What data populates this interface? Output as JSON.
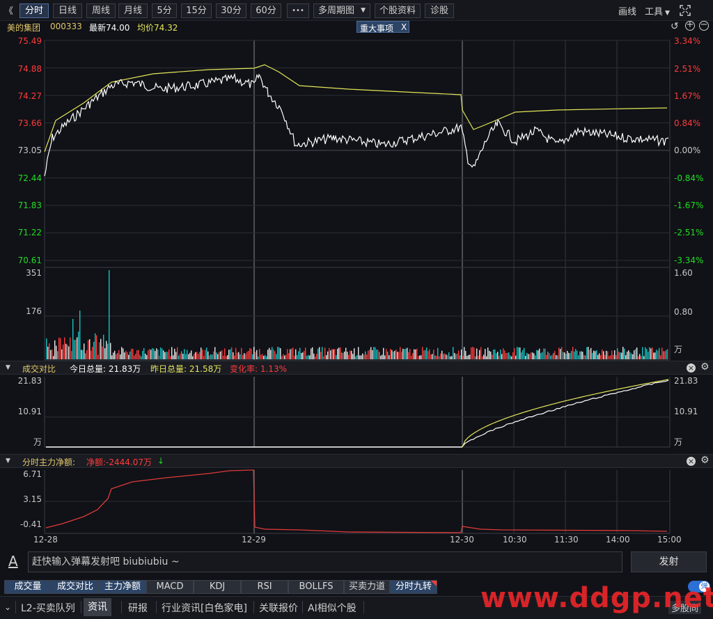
{
  "toolbar": {
    "collapse_glyph": "《",
    "periods": [
      "分时",
      "日线",
      "周线",
      "月线",
      "5分",
      "15分",
      "30分",
      "60分"
    ],
    "more_glyph": "•••",
    "multi_period": "多周期图",
    "stock_profile": "个股资料",
    "diagnose": "诊股",
    "draw_line": "画线",
    "tools": "工具",
    "fullscreen_icon": "expand-icon"
  },
  "stock": {
    "name": "美的集团",
    "code": "000333",
    "latest": "最新74.00",
    "avg_price": "均价74.32",
    "event_tag": "重大事项",
    "event_close": "X"
  },
  "price_axis": {
    "left": [
      "75.49",
      "74.88",
      "74.27",
      "73.66",
      "73.05",
      "72.44",
      "71.83",
      "71.22",
      "70.61"
    ],
    "right": [
      "3.34%",
      "2.51%",
      "1.67%",
      "0.84%",
      "0.00%",
      "-0.84%",
      "-1.67%",
      "-2.51%",
      "-3.34%"
    ]
  },
  "volume_axis": {
    "left": [
      "351",
      "176"
    ],
    "right": [
      "1.60",
      "0.80",
      "万"
    ]
  },
  "ratio_panel": {
    "title": "成交对比",
    "today_total": "今日总量: 21.83万",
    "yesterday_total": "昨日总量: 21.58万",
    "change_rate": "变化率: 1.13%",
    "left": [
      "21.83",
      "10.91",
      "万"
    ],
    "right": [
      "21.83",
      "10.91",
      "万"
    ]
  },
  "fund_panel": {
    "title": "分时主力净额:",
    "net_label": "净额:-2444.07万",
    "net_arrow": "↓",
    "left": [
      "6.71",
      "3.15",
      "-0.41"
    ]
  },
  "time_axis": [
    "12-28",
    "12-29",
    "12-30",
    "10:30",
    "11:30",
    "14:00",
    "15:00"
  ],
  "danmu": {
    "icon": "A",
    "placeholder": "赶快输入弹幕发射吧 biubiubiu ~",
    "send": "发射"
  },
  "indicator_tabs": [
    "成交量",
    "成交对比",
    "主力净额",
    "MACD",
    "KDJ",
    "RSI",
    "BOLLFS",
    "买卖力道",
    "分时九转"
  ],
  "toggle_label": "弹",
  "bottom_tabs": [
    "L2-买卖队列",
    "资讯",
    "研报",
    "行业资讯[白色家电]",
    "关联报价",
    "AI相似个股"
  ],
  "bottom_right": "多股同",
  "watermark": "www.ddgp.net",
  "colors": {
    "up": "#ff3b3b",
    "down": "#22dd22",
    "avg": "#e6e65a",
    "price": "#ffffff",
    "fund": "#e03a3a",
    "accent": "#2c4466"
  }
}
